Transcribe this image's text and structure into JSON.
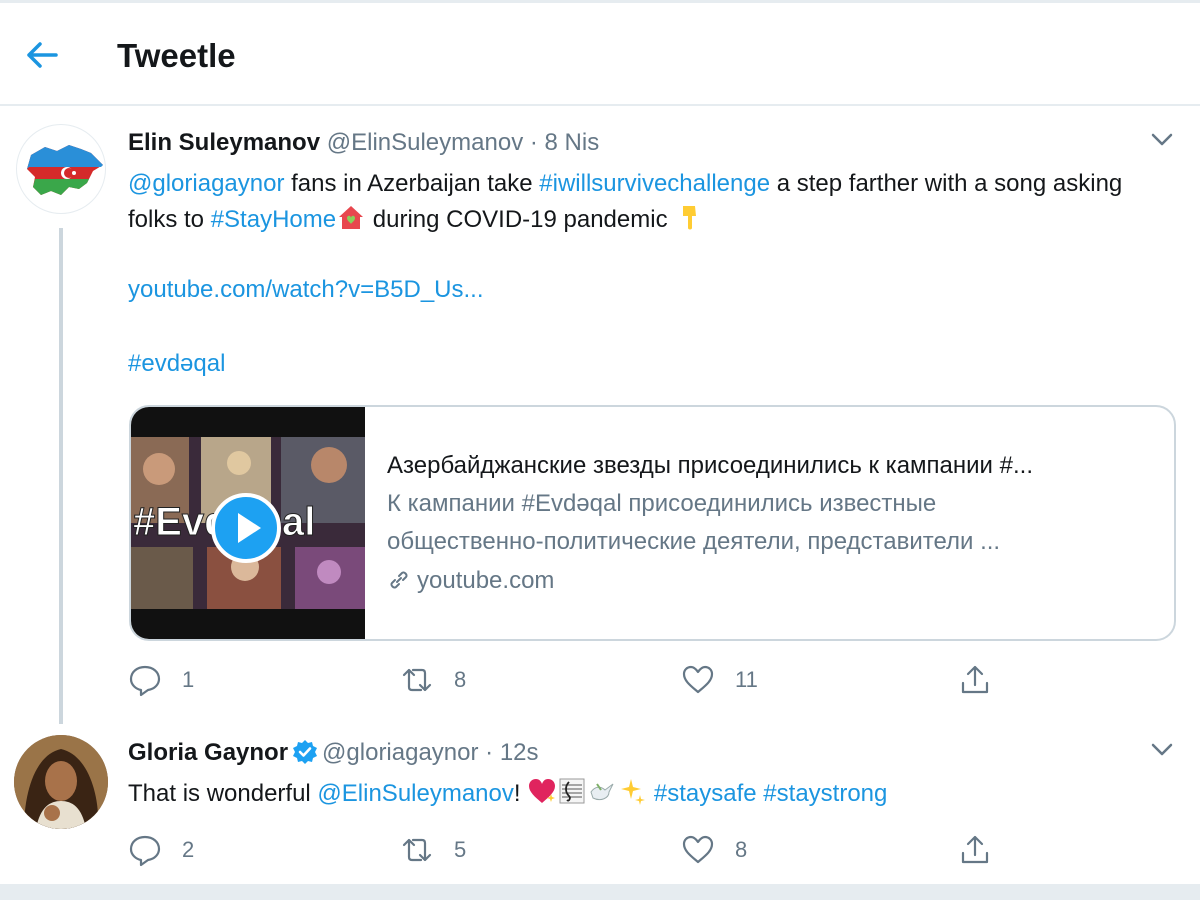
{
  "header": {
    "title": "Tweetle"
  },
  "tweets": [
    {
      "display_name": "Elin Suleymanov",
      "handle": "@ElinSuleymanov",
      "sep": " · ",
      "time": "8 Nis",
      "text": {
        "mention": "@gloriagaynor",
        "part1": " fans in Azerbaijan take ",
        "hashtag1": "#iwillsurvivechallenge",
        "part2": " a step farther with a song asking folks to ",
        "hashtag2": "#StayHome",
        "part3": " during COVID-19 pandemic "
      },
      "link": "youtube.com/watch?v=B5D_Us...",
      "hashtag_line": "#evdəqal",
      "card": {
        "thumb_text": "#EvdəQal",
        "title": "Азербайджанские звезды присоединились к кампании #...",
        "desc_line1": "К кампании #Evdəqal присоединились известные",
        "desc_line2": "общественно-политические деятели, представители ...",
        "domain": "youtube.com"
      },
      "actions": {
        "reply": "1",
        "retweet": "8",
        "like": "11"
      }
    },
    {
      "display_name": "Gloria Gaynor",
      "handle": "@gloriagaynor",
      "sep": " · ",
      "time": "12s",
      "verified": true,
      "text": {
        "part1": "That is wonderful ",
        "mention": "@ElinSuleymanov",
        "part2": "! ",
        "hashtag1": "#staysafe",
        "hashtag2": "#staystrong"
      },
      "actions": {
        "reply": "2",
        "retweet": "5",
        "like": "8"
      }
    }
  ],
  "icons": {
    "back": "arrow-left-icon",
    "caret": "chevron-down-icon",
    "reply": "reply-icon",
    "retweet": "retweet-icon",
    "like": "heart-icon",
    "share": "share-icon",
    "link": "link-icon",
    "play": "play-icon",
    "verified": "verified-badge-icon"
  },
  "colors": {
    "accent": "#1b95e0",
    "text": "#14171a",
    "secondary": "#657786",
    "border": "#ccd6dd"
  }
}
